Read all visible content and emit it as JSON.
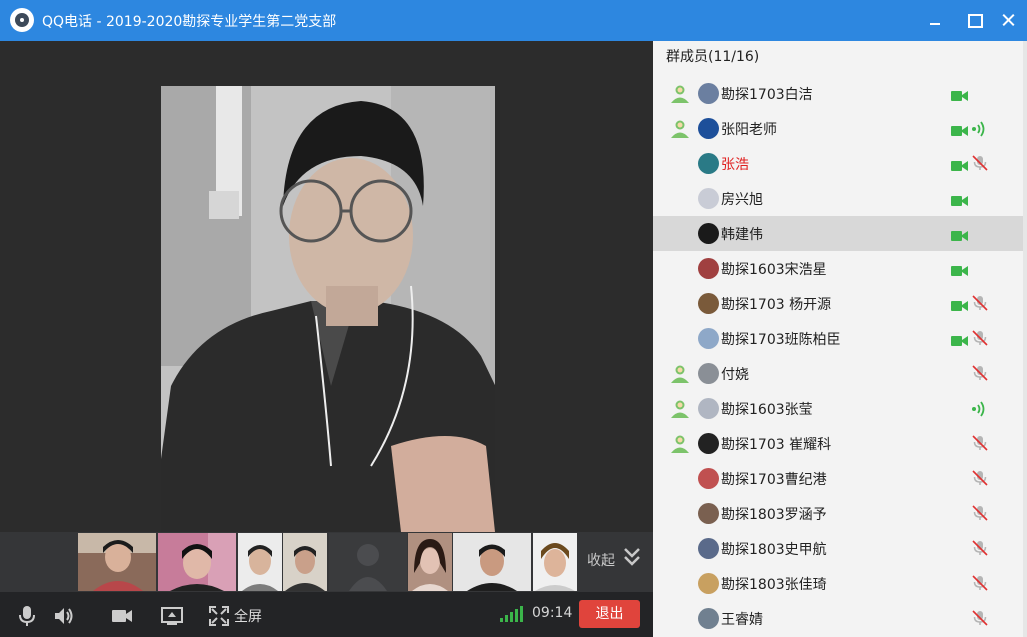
{
  "window": {
    "title": "QQ电话 - 2019-2020勘探专业学生第二党支部"
  },
  "thumbnails": {
    "collapse_label": "收起",
    "items": [
      {
        "icon": "person-video"
      },
      {
        "icon": "person-video"
      },
      {
        "icon": "person-video"
      },
      {
        "icon": "person-video"
      },
      {
        "icon": "placeholder-avatar"
      },
      {
        "icon": "person-video"
      },
      {
        "icon": "person-video"
      },
      {
        "icon": "person-video"
      }
    ]
  },
  "toolbar": {
    "fullscreen_label": "全屏",
    "timer": "09:14",
    "exit_label": "退出"
  },
  "members": {
    "count_label": "群成员(11/16)",
    "list": [
      {
        "name": "勘探1703白洁",
        "admin": true,
        "camera": true,
        "audio": "none",
        "avatar_color": "#6b7fa0"
      },
      {
        "name": "张阳老师",
        "admin": true,
        "camera": true,
        "audio": "speaking",
        "avatar_color": "#1d4f9a"
      },
      {
        "name": "张浩",
        "admin": false,
        "camera": true,
        "audio": "muted",
        "avatar_color": "#2a7a86",
        "highlight": "red"
      },
      {
        "name": "房兴旭",
        "admin": false,
        "camera": true,
        "audio": "none",
        "avatar_color": "#c9ccd6"
      },
      {
        "name": "韩建伟",
        "admin": false,
        "camera": true,
        "audio": "none",
        "avatar_color": "#1a1a1a",
        "selected": true
      },
      {
        "name": "勘探1603宋浩星",
        "admin": false,
        "camera": true,
        "audio": "none",
        "avatar_color": "#a04040"
      },
      {
        "name": "勘探1703 杨开源",
        "admin": false,
        "camera": true,
        "audio": "muted",
        "avatar_color": "#7a5a3a"
      },
      {
        "name": "勘探1703班陈柏臣",
        "admin": false,
        "camera": true,
        "audio": "muted",
        "avatar_color": "#8ea8c8"
      },
      {
        "name": "付娆",
        "admin": true,
        "camera": false,
        "audio": "muted",
        "avatar_color": "#8a8f96"
      },
      {
        "name": "勘探1603张莹",
        "admin": true,
        "camera": false,
        "audio": "speaking",
        "avatar_color": "#b0b6c2"
      },
      {
        "name": "勘探1703 崔耀科",
        "admin": true,
        "camera": false,
        "audio": "muted",
        "avatar_color": "#222222"
      },
      {
        "name": "勘探1703曹纪港",
        "admin": false,
        "camera": false,
        "audio": "muted",
        "avatar_color": "#c05050"
      },
      {
        "name": "勘探1803罗涵予",
        "admin": false,
        "camera": false,
        "audio": "muted",
        "avatar_color": "#7a6050"
      },
      {
        "name": "勘探1803史甲航",
        "admin": false,
        "camera": false,
        "audio": "muted",
        "avatar_color": "#5a6a8a"
      },
      {
        "name": "勘探1803张佳琦",
        "admin": false,
        "camera": false,
        "audio": "muted",
        "avatar_color": "#c8a060"
      },
      {
        "name": "王睿婧",
        "admin": false,
        "camera": false,
        "audio": "muted",
        "avatar_color": "#708090"
      }
    ]
  },
  "colors": {
    "titlebar": "#2d87e0",
    "exit_button": "#e0443c",
    "active_green": "#3bb54a",
    "muted_red": "#e03030",
    "selected_row": "#d8d8d8"
  }
}
